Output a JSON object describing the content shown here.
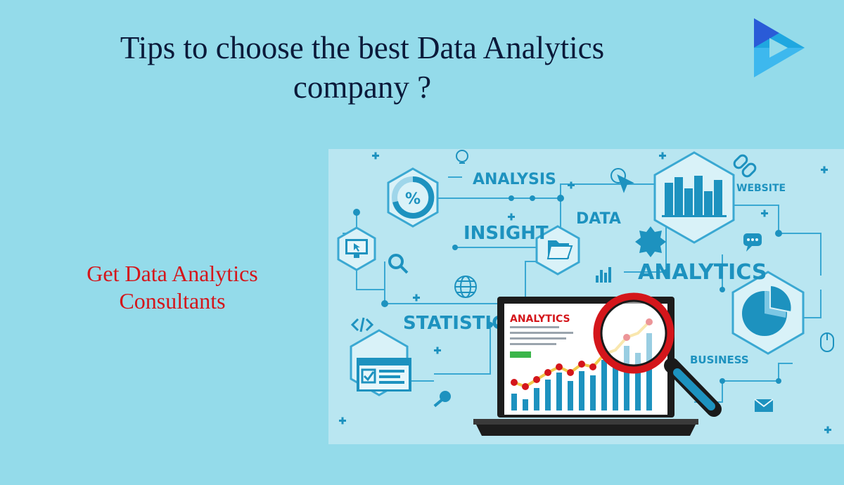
{
  "header": {
    "title_line1": "Tips to choose the best Data Analytics",
    "title_line2": "company ?"
  },
  "logo": {
    "icon": "play-logo-icon",
    "colors": [
      "#2a5bd7",
      "#1fa7e0",
      "#47c6f5"
    ]
  },
  "cta": {
    "line1": "Get Data Analytics",
    "line2": "Consultants",
    "color": "#d4161b"
  },
  "illustration": {
    "background": "#b9e6f1",
    "accent": "#1d92bf",
    "labels": {
      "analysis": "ANALYSIS",
      "data": "DATA",
      "insight": "INSIGHT",
      "analytics_big": "ANALYTICS",
      "statistics": "STATISTICS",
      "website": "WEBSITE",
      "business": "BUSINESS",
      "screen_title": "ANALYTICS",
      "percent": "%"
    },
    "icons": [
      "percent-gauge-icon",
      "monitor-cursor-icon",
      "search-icon",
      "globe-icon",
      "code-icon",
      "checklist-form-icon",
      "key-icon",
      "folder-icon",
      "bar-chart-icon",
      "pie-chart-icon",
      "mouse-icon",
      "envelope-icon",
      "link-icon",
      "chat-bubble-icon",
      "lightbulb-icon",
      "award-badge-icon",
      "click-cursor-icon",
      "laptop-icon",
      "magnifying-glass-icon"
    ]
  }
}
